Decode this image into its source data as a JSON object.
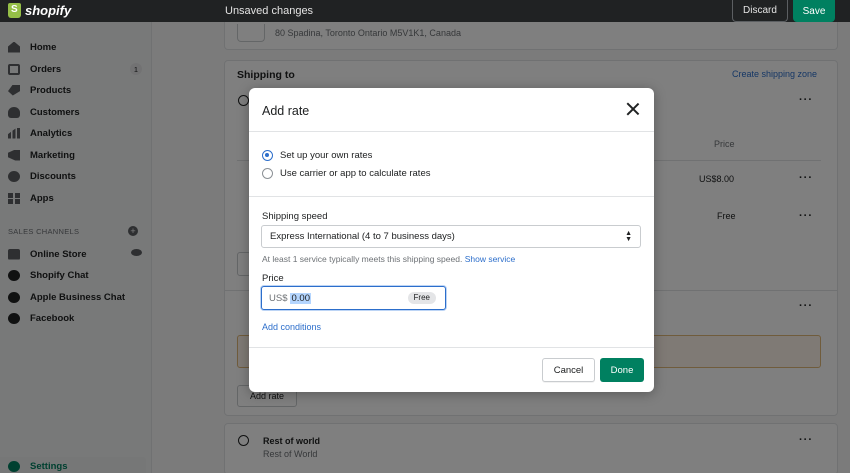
{
  "topbar": {
    "brand": "shopify",
    "status": "Unsaved changes",
    "discard_label": "Discard",
    "save_label": "Save"
  },
  "sidebar": {
    "items": [
      {
        "label": "Home",
        "icon": "home-icon"
      },
      {
        "label": "Orders",
        "icon": "orders-icon",
        "badge": "1"
      },
      {
        "label": "Products",
        "icon": "tag-icon"
      },
      {
        "label": "Customers",
        "icon": "person-icon"
      },
      {
        "label": "Analytics",
        "icon": "bar-chart-icon"
      },
      {
        "label": "Marketing",
        "icon": "megaphone-icon"
      },
      {
        "label": "Discounts",
        "icon": "discount-icon"
      },
      {
        "label": "Apps",
        "icon": "apps-icon"
      }
    ],
    "section_label": "SALES CHANNELS",
    "channels": [
      {
        "label": "Online Store",
        "icon": "store-icon"
      },
      {
        "label": "Shopify Chat",
        "icon": "chat-icon"
      },
      {
        "label": "Apple Business Chat",
        "icon": "message-icon"
      },
      {
        "label": "Facebook",
        "icon": "facebook-icon"
      }
    ],
    "settings_label": "Settings"
  },
  "background": {
    "address": "80 Spadina, Toronto Ontario M5V1K1, Canada",
    "shipping_to": "Shipping to",
    "create_zone": "Create shipping zone",
    "price_header": "Price",
    "rate_1_price": "US$8.00",
    "rate_2_price": "Free",
    "add_rate": "Add rate",
    "rest_of_world": "Rest of world",
    "rest_of_world_sub": "Rest of World"
  },
  "modal": {
    "title": "Add rate",
    "options": [
      {
        "label": "Set up your own rates",
        "selected": true
      },
      {
        "label": "Use carrier or app to calculate rates",
        "selected": false
      }
    ],
    "shipping_speed_label": "Shipping speed",
    "shipping_speed_value": "Express International (4 to 7 business days)",
    "helper_text": "At least 1 service typically meets this shipping speed.",
    "helper_link": "Show service",
    "price_label": "Price",
    "price_prefix": "US$",
    "price_value": "0.00",
    "price_badge": "Free",
    "add_conditions": "Add conditions",
    "cancel_label": "Cancel",
    "done_label": "Done"
  },
  "colors": {
    "topbar": "#202223",
    "primary": "#008060",
    "link": "#2c6ecb"
  }
}
